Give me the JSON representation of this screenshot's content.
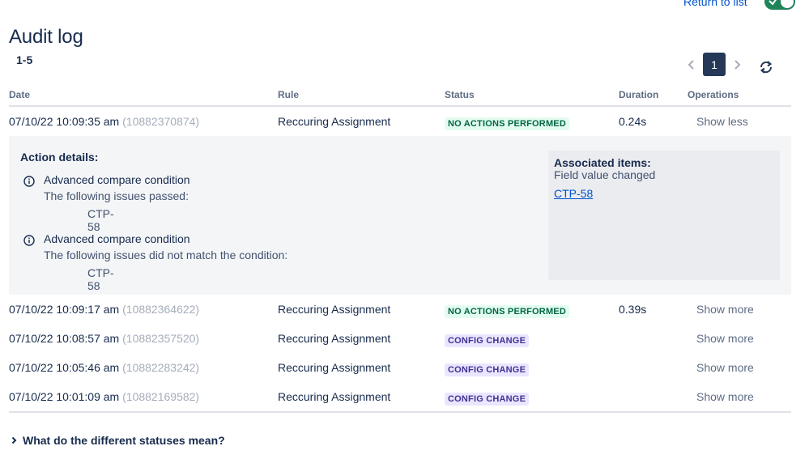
{
  "header": {
    "return_link": "Return to list",
    "title": "Audit log",
    "range": "1-5",
    "toggle_on": true
  },
  "pagination": {
    "current_page": "1"
  },
  "table": {
    "columns": [
      "Date",
      "Rule",
      "Status",
      "Duration",
      "Operations"
    ],
    "rows": [
      {
        "date": "07/10/22 10:09:35 am",
        "id": "(10882370874)",
        "rule": "Reccuring Assignment",
        "status": "NO ACTIONS PERFORMED",
        "status_color": "#006644",
        "duration": "0.24s",
        "operation": "Show less"
      },
      {
        "date": "07/10/22 10:09:17 am",
        "id": "(10882364622)",
        "rule": "Reccuring Assignment",
        "status": "NO ACTIONS PERFORMED",
        "status_color": "#006644",
        "duration": "0.39s",
        "operation": "Show more"
      },
      {
        "date": "07/10/22 10:08:57 am",
        "id": "(10882357520)",
        "rule": "Reccuring Assignment",
        "status": "CONFIG CHANGE",
        "status_color": "#403294",
        "duration": "",
        "operation": "Show more"
      },
      {
        "date": "07/10/22 10:05:46 am",
        "id": "(10882283242)",
        "rule": "Reccuring Assignment",
        "status": "CONFIG CHANGE",
        "status_color": "#403294",
        "duration": "",
        "operation": "Show more"
      },
      {
        "date": "07/10/22 10:01:09 am",
        "id": "(10882169582)",
        "rule": "Reccuring Assignment",
        "status": "CONFIG CHANGE",
        "status_color": "#403294",
        "duration": "",
        "operation": "Show more"
      }
    ]
  },
  "details": {
    "heading": "Action details:",
    "conditions": [
      {
        "title": "Advanced compare condition",
        "subtitle": "The following issues passed:",
        "issue": "CTP-58"
      },
      {
        "title": "Advanced compare condition",
        "subtitle": "The following issues did not match the condition:",
        "issue": "CTP-58"
      }
    ],
    "associated": {
      "title": "Associated items:",
      "subtitle": "Field value changed",
      "link": "CTP-58"
    }
  },
  "footer": {
    "faq": "What do the different statuses mean?"
  },
  "icons": {
    "info": "info-icon",
    "refresh": "refresh-icon",
    "chevron_left": "chevron-left-icon",
    "chevron_right": "chevron-right-icon",
    "expand": "chevron-right-icon"
  }
}
